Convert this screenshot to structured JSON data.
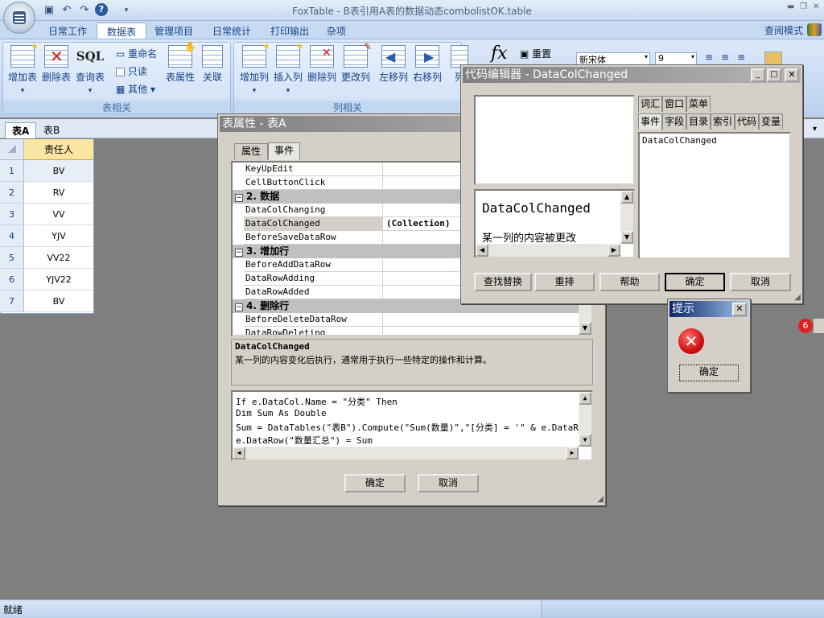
{
  "app": {
    "title": "FoxTable - B表引用A表的数据动态combolistOK.table",
    "view_mode": "查阅模式"
  },
  "ribbon": {
    "tabs": [
      "日常工作",
      "数据表",
      "管理项目",
      "日常统计",
      "打印输出",
      "杂项"
    ],
    "active_tab": "数据表",
    "table_group": {
      "label": "表相关",
      "add_table": "增加表",
      "delete_table": "删除表",
      "query_table": "查询表",
      "sql_text": "SQL",
      "rename": "重命名",
      "readonly": "只读",
      "other": "其他",
      "table_props": "表属性",
      "relation": "关联"
    },
    "column_group": {
      "label": "列相关",
      "add_col": "增加列",
      "insert_col": "插入列",
      "delete_col": "删除列",
      "change_col": "更改列",
      "move_left": "左移列",
      "move_right": "右移列",
      "col_truncated": "列",
      "reset": "重置",
      "fx": "fx"
    },
    "format": {
      "font": "新宋体",
      "size": "9"
    }
  },
  "sheet_tabs": [
    "表A",
    "表B"
  ],
  "grid": {
    "column_header": "责任人",
    "rows": [
      {
        "n": "1",
        "v": "BV"
      },
      {
        "n": "2",
        "v": "RV"
      },
      {
        "n": "3",
        "v": "VV"
      },
      {
        "n": "4",
        "v": "YJV"
      },
      {
        "n": "5",
        "v": "VV22"
      },
      {
        "n": "6",
        "v": "YJV22"
      },
      {
        "n": "7",
        "v": "BV"
      }
    ]
  },
  "status": {
    "text": "就绪"
  },
  "props_dialog": {
    "title": "表属性 - 表A",
    "tabs": [
      "属性",
      "事件"
    ],
    "active_tab": "事件",
    "rows": [
      {
        "kind": "item",
        "name": "KeyUpEdit",
        "value": ""
      },
      {
        "kind": "item",
        "name": "CellButtonClick",
        "value": ""
      },
      {
        "kind": "cat",
        "name": "2. 数据"
      },
      {
        "kind": "item",
        "name": "DataColChanging",
        "value": ""
      },
      {
        "kind": "item",
        "name": "DataColChanged",
        "value": "(Collection)"
      },
      {
        "kind": "item",
        "name": "BeforeSaveDataRow",
        "value": ""
      },
      {
        "kind": "cat",
        "name": "3. 增加行"
      },
      {
        "kind": "item",
        "name": "BeforeAddDataRow",
        "value": ""
      },
      {
        "kind": "item",
        "name": "DataRowAdding",
        "value": ""
      },
      {
        "kind": "item",
        "name": "DataRowAdded",
        "value": ""
      },
      {
        "kind": "cat",
        "name": "4. 删除行"
      },
      {
        "kind": "item",
        "name": "BeforeDeleteDataRow",
        "value": ""
      },
      {
        "kind": "item",
        "name": "DataRowDeleting",
        "value": ""
      }
    ],
    "desc_title": "DataColChanged",
    "desc_text": "某一列的内容变化后执行，通常用于执行一些特定的操作和计算。",
    "code_lines": [
      "If e.DataCol.Name = \"分类\" Then",
      "    Dim Sum As Double",
      "    Sum = DataTables(\"表B\").Compute(\"Sum(数量)\",\"[分类] = '\" & e.DataRow",
      "    e.DataRow(\"数量汇总\") = Sum"
    ],
    "ok": "确定",
    "cancel": "取消"
  },
  "code_editor": {
    "title": "代码编辑器 - DataColChanged",
    "tabs_row1": [
      "词汇",
      "窗口",
      "菜单"
    ],
    "tabs_row2": [
      "事件",
      "字段",
      "目录",
      "索引",
      "代码",
      "变量"
    ],
    "list_item": "DataColChanged",
    "help_title": "DataColChanged",
    "help_text": "某一列的内容被更改",
    "buttons": {
      "find": "查找替换",
      "reformat": "重排",
      "help": "帮助",
      "ok": "确定",
      "cancel": "取消"
    }
  },
  "tip_dialog": {
    "title": "提示",
    "ok": "确定"
  },
  "colors": {
    "active_title": "#0a246a",
    "inactive_title": "#808080",
    "header_yellow": "#fae5a3"
  }
}
